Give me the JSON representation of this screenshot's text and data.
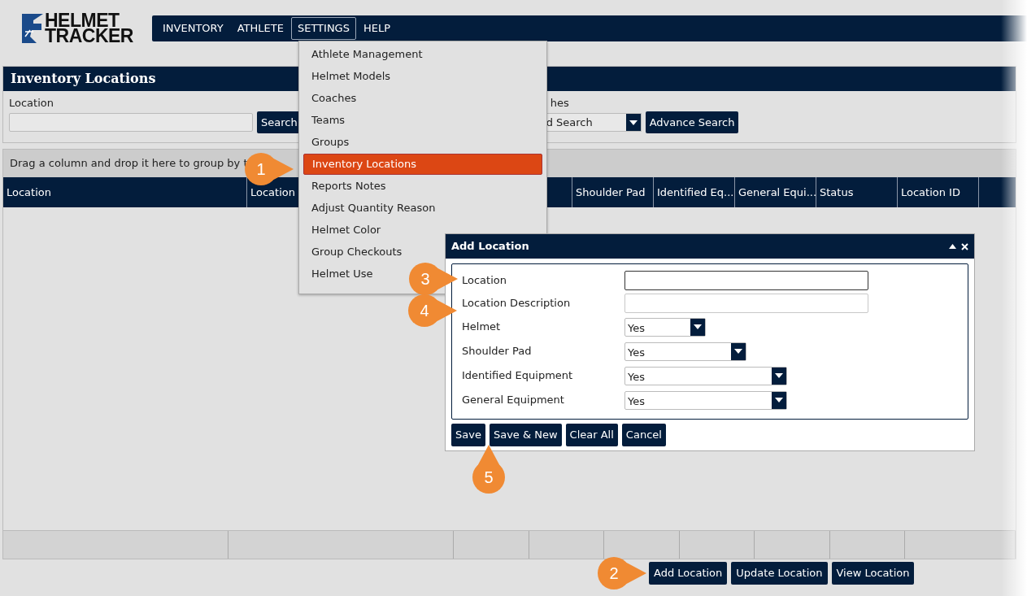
{
  "logo": {
    "line1": "HELMET",
    "line2": "TRACKER"
  },
  "nav": [
    {
      "label": "INVENTORY",
      "selected": false
    },
    {
      "label": "ATHLETE",
      "selected": false
    },
    {
      "label": "SETTINGS",
      "selected": true
    },
    {
      "label": "HELP",
      "selected": false
    }
  ],
  "settings_menu": [
    {
      "label": "Athlete Management",
      "selected": false
    },
    {
      "label": "Helmet Models",
      "selected": false
    },
    {
      "label": "Coaches",
      "selected": false
    },
    {
      "label": "Teams",
      "selected": false
    },
    {
      "label": "Groups",
      "selected": false
    },
    {
      "label": "Inventory Locations",
      "selected": true
    },
    {
      "label": "Reports Notes",
      "selected": false
    },
    {
      "label": "Adjust Quantity Reason",
      "selected": false
    },
    {
      "label": "Helmet Color",
      "selected": false
    },
    {
      "label": "Group Checkouts",
      "selected": false
    },
    {
      "label": "Helmet Use",
      "selected": false
    }
  ],
  "panel": {
    "title": "Inventory Locations",
    "search_label": "Location",
    "search_button": "Search",
    "matches_label": "hes",
    "matches_select": "d Search",
    "advance_button": "Advance Search"
  },
  "grid": {
    "group_hint": "Drag a column and drop it here to group by t",
    "columns": [
      {
        "label": "Location"
      },
      {
        "label": "Location"
      },
      {},
      {
        "label": "Shoulder Pad"
      },
      {
        "label": "Identified Eq..."
      },
      {
        "label": "General Equi..."
      },
      {
        "label": "Status"
      },
      {
        "label": "Location ID"
      }
    ]
  },
  "actions": [
    "Add Location",
    "Update Location",
    "View Location"
  ],
  "dialog": {
    "title": "Add Location",
    "fields": [
      {
        "kind": "text",
        "label": "Location",
        "focused": true
      },
      {
        "kind": "text",
        "label": "Location Description",
        "focused": false
      },
      {
        "kind": "select",
        "label": "Helmet",
        "value": "Yes"
      },
      {
        "kind": "select",
        "label": "Shoulder Pad",
        "value": "Yes"
      },
      {
        "kind": "select",
        "label": "Identified Equipment",
        "value": "Yes"
      },
      {
        "kind": "select",
        "label": "General Equipment",
        "value": "Yes"
      }
    ],
    "buttons": [
      "Save",
      "Save & New",
      "Clear All",
      "Cancel"
    ]
  },
  "callouts": [
    {
      "number": "1",
      "kind": "right"
    },
    {
      "number": "2",
      "kind": "right"
    },
    {
      "number": "3",
      "kind": "right"
    },
    {
      "number": "4",
      "kind": "right"
    },
    {
      "number": "5",
      "kind": "up"
    }
  ]
}
